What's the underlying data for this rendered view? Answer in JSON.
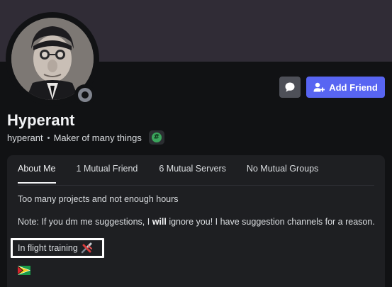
{
  "profile": {
    "display_name": "Hyperant",
    "username": "hyperant",
    "tagline": "Maker of many things",
    "badge_symbol": "#",
    "status": "offline"
  },
  "actions": {
    "add_friend_label": "Add Friend"
  },
  "tabs": [
    {
      "label": "About Me",
      "active": true
    },
    {
      "label": "1 Mutual Friend",
      "active": false
    },
    {
      "label": "6 Mutual Servers",
      "active": false
    },
    {
      "label": "No Mutual Groups",
      "active": false
    }
  ],
  "bio": {
    "line1": "Too many projects and not enough hours",
    "note_pre": "Note: If you dm me suggestions, I ",
    "note_bold": "will",
    "note_post": " ignore you! I have suggestion channels for a reason.",
    "line3": "In flight training",
    "line3_icon": "airplane-icon",
    "flag_icon": "flag-icon"
  },
  "colors": {
    "accent": "#5865f2",
    "banner": "#302c36",
    "background": "#111214",
    "panel": "#1e1f22",
    "status_offline": "#80848e",
    "badge_green": "#3ba55c"
  }
}
